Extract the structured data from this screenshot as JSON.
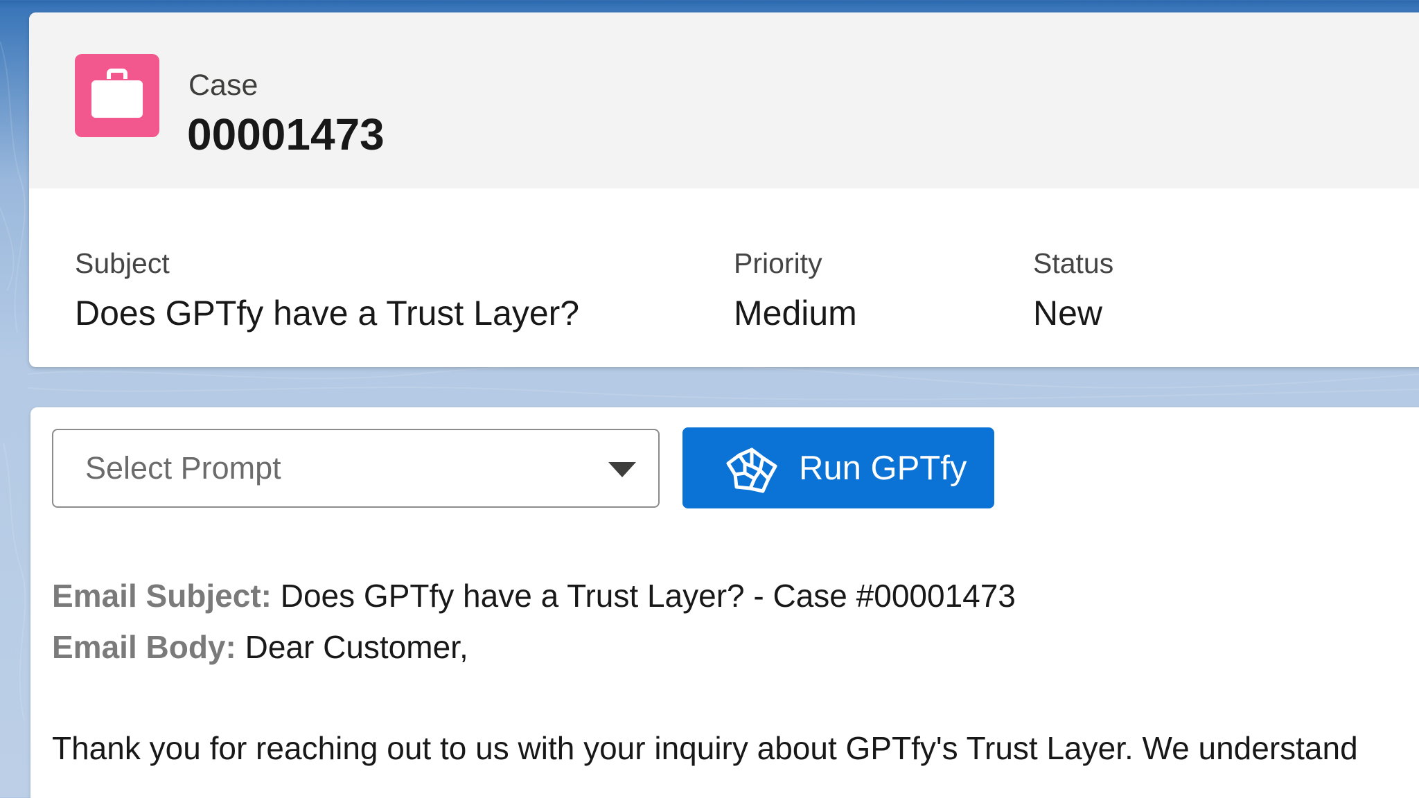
{
  "header": {
    "object_label": "Case",
    "record_number": "00001473"
  },
  "highlights": {
    "subject": {
      "label": "Subject",
      "value": "Does GPTfy have a Trust Layer?"
    },
    "priority": {
      "label": "Priority",
      "value": "Medium"
    },
    "status": {
      "label": "Status",
      "value": "New"
    }
  },
  "gptfy": {
    "select_placeholder": "Select Prompt",
    "run_button_label": "Run GPTfy"
  },
  "response": {
    "subject_key": "Email Subject:",
    "subject_value": "Does GPTfy have a Trust Layer? - Case #00001473",
    "body_key": "Email Body:",
    "body_greeting": "Dear Customer,",
    "body_paragraph": "Thank you for reaching out to us with your inquiry about GPTfy's Trust Layer. We understand"
  },
  "colors": {
    "case_icon_bg": "#f2588d",
    "brand_button": "#0b72d6",
    "page_bg": "#2a67ad"
  },
  "icons": {
    "case": "briefcase-icon",
    "run": "gptfy-spark-icon",
    "dropdown": "chevron-down-icon"
  }
}
